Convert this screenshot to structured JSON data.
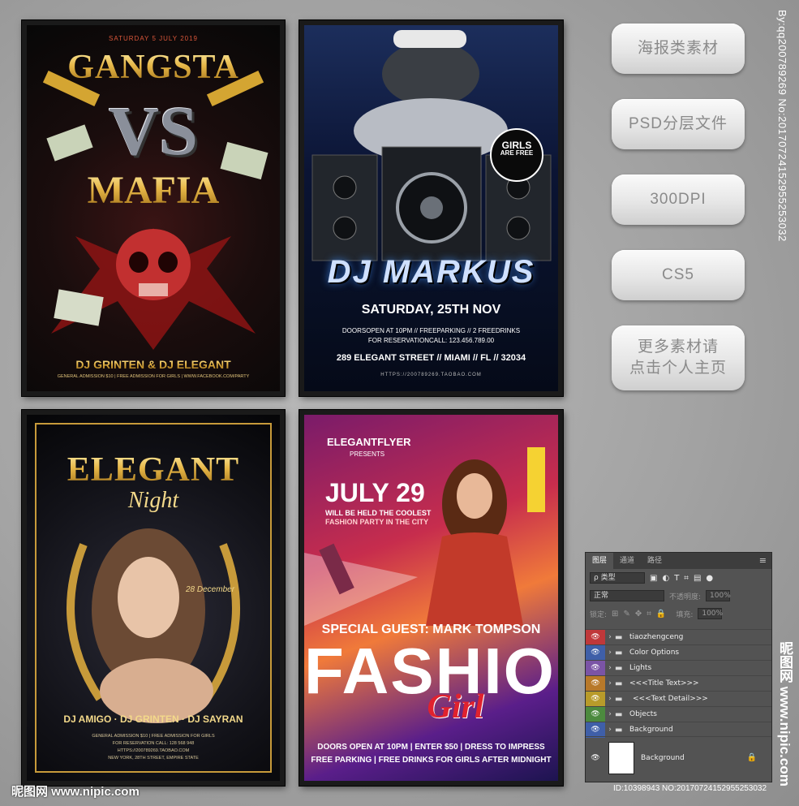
{
  "posters": {
    "gangsta": {
      "date": "SATURDAY 5 JULY 2019",
      "title_top": "GANGSTA",
      "title_vs": "VS",
      "title_bottom": "MAFIA",
      "djs": "DJ GRINTEN & DJ ELEGANT",
      "footer": "GENERAL ADMISSION $10 | FREE ADMISSION FOR GIRLS | WWW.FACEBOOK.COM/PARTY"
    },
    "markus": {
      "badge_line1": "GIRLS",
      "badge_line2": "ARE FREE",
      "dj_name": "DJ MARKUS",
      "date": "SATURDAY, 25TH NOV",
      "info1": "DOORSOPEN AT 10PM // FREEPARKING // 2 FREEDRINKS",
      "info2": "FOR RESERVATIONCALL: 123.456.789.00",
      "address": "289 ELEGANT STREET // MIAMI // FL // 32034",
      "url": "HTTPS://200789269.TAOBAO.COM"
    },
    "elegant": {
      "title": "ELEGANT",
      "subtitle": "Night",
      "date_small": "28 December",
      "djs": "DJ AMIGO · DJ GRINTEN · DJ SAYRAN",
      "info1": "GENERAL ADMISSION $10 | FREE ADMISSION FOR GIRLS",
      "info2": "FOR RESERVATION CALL: 128 568 948",
      "info3": "HTTPS://200789269.TAOBAO.COM",
      "info4": "NEW YORK, 28TH STREET, EMPIRE STATE"
    },
    "fashion": {
      "brand": "ELEGANTFLYER",
      "presents": "PRESENTS",
      "date": "JULY 29",
      "tagline1": "WILL BE HELD THE COOLEST",
      "tagline2": "FASHION PARTY IN THE CITY",
      "guest": "SPECIAL GUEST: MARK TOMPSON",
      "title": "FASHION",
      "script": "Girl",
      "info1": "DOORS OPEN AT 10PM | ENTER $50 | DRESS TO IMPRESS",
      "info2": "FREE PARKING | FREE DRINKS FOR GIRLS AFTER MIDNIGHT"
    }
  },
  "side_buttons": [
    {
      "label": "海报类素材"
    },
    {
      "label": "PSD分层文件"
    },
    {
      "label": "300DPI"
    },
    {
      "label": "CS5"
    },
    {
      "label": "更多素材请\n点击个人主页"
    }
  ],
  "layers_panel": {
    "tabs": [
      "图层",
      "通道",
      "路径"
    ],
    "filter_label": "ρ 类型",
    "blend_mode": "正常",
    "opacity_label": "不透明度:",
    "opacity_value": "100%",
    "lock_label": "锁定:",
    "fill_label": "填充:",
    "fill_value": "100%",
    "layers": [
      {
        "name": "tiaozhengceng",
        "color": "#c0383a"
      },
      {
        "name": "Color Options",
        "color": "#3f5fa8"
      },
      {
        "name": "Lights",
        "color": "#7b54a6"
      },
      {
        "name": "<<<Title Text>>>",
        "color": "#b8792a"
      },
      {
        "name": "<<<Text Detail>>>",
        "color": "#b89b2a"
      },
      {
        "name": "Objects",
        "color": "#4c8a3e"
      },
      {
        "name": "Background",
        "color": "#3f5fa8"
      }
    ],
    "background_layer": "Background"
  },
  "watermarks": {
    "bottom_left": "昵图网 www.nipic.com",
    "id_line": "ID:10398943 NO:20170724152955253032",
    "vertical": "By:qq200789269 No:20170724152955253032",
    "vertical_site": "昵图网 www.nipic.com"
  },
  "colors": {
    "button_text": "#8a8a8a",
    "panel_bg": "#535353",
    "background": "#a3a3a3"
  }
}
